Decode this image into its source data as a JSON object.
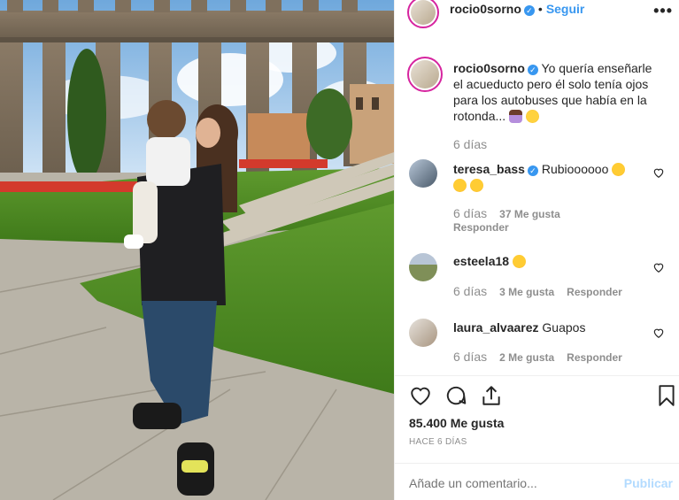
{
  "post": {
    "author": "rocio0sorno",
    "follow_label": "Seguir",
    "more_label": "•••",
    "caption": "Yo quería enseñarle el acueducto pero él solo tenía ojos para los autobuses que había en la rotonda...",
    "caption_time": "6 días",
    "likes": "85.400 Me gusta",
    "posted_ago": "HACE 6 DÍAS"
  },
  "comments": [
    {
      "user": "teresa_bass",
      "verified": true,
      "text": "Rubioooooo",
      "time": "6 días",
      "likes": "37 Me gusta",
      "reply": "Responder"
    },
    {
      "user": "esteela18",
      "verified": false,
      "text": "",
      "time": "6 días",
      "likes": "3 Me gusta",
      "reply": "Responder"
    },
    {
      "user": "laura_alvaarez",
      "verified": false,
      "text": "Guapos",
      "time": "6 días",
      "likes": "2 Me gusta",
      "reply": "Responder"
    }
  ],
  "composer": {
    "placeholder": "Añade un comentario...",
    "publish_label": "Publicar"
  },
  "icons": {
    "like": "heart-icon",
    "comment": "comment-bubble-icon",
    "share": "share-icon",
    "save": "bookmark-icon",
    "verified": "verified-badge-icon",
    "options": "more-options-icon"
  },
  "colors": {
    "link_blue": "#3897f0",
    "verified_blue": "#3897f0",
    "muted": "#8e8e8e",
    "publish_disabled": "#b3dbff",
    "text": "#262626"
  }
}
